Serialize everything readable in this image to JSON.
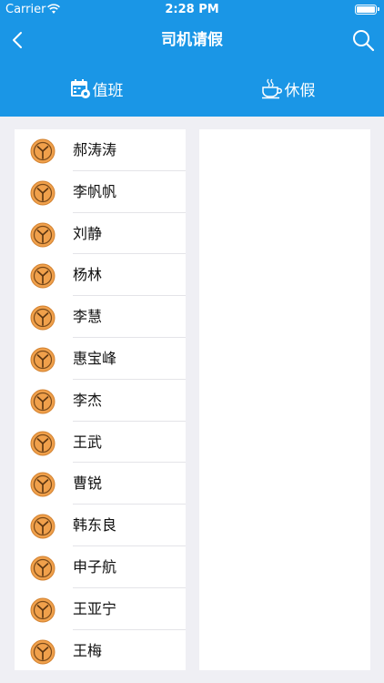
{
  "status": {
    "carrier": "Carrier",
    "time": "2:28 PM"
  },
  "nav": {
    "title": "司机请假"
  },
  "tabs": [
    {
      "label": "值班",
      "icon": "calendar-icon"
    },
    {
      "label": "休假",
      "icon": "coffee-cup-icon"
    }
  ],
  "drivers": [
    {
      "name": "郝涛涛"
    },
    {
      "name": "李帆帆"
    },
    {
      "name": "刘静"
    },
    {
      "name": "杨林"
    },
    {
      "name": "李慧"
    },
    {
      "name": "惠宝峰"
    },
    {
      "name": "李杰"
    },
    {
      "name": "王武"
    },
    {
      "name": "曹锐"
    },
    {
      "name": "韩东良"
    },
    {
      "name": "申子航"
    },
    {
      "name": "王亚宁"
    },
    {
      "name": "王梅"
    }
  ],
  "colors": {
    "primary": "#1a96e6",
    "avatar": "#f0a04b",
    "background": "#efeff4"
  }
}
